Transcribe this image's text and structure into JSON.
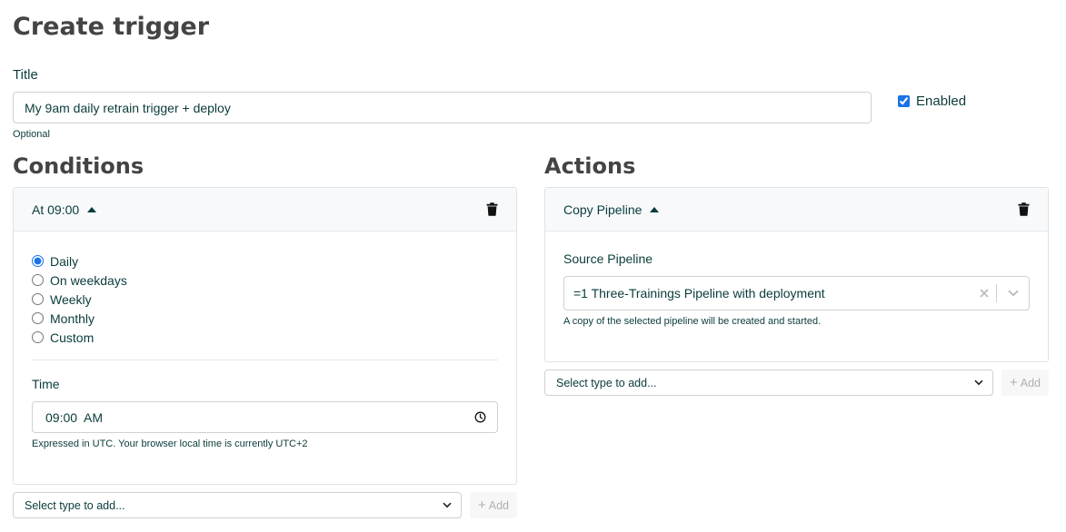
{
  "page": {
    "title": "Create trigger"
  },
  "title_field": {
    "label": "Title",
    "value": "My 9am daily retrain trigger + deploy",
    "hint": "Optional"
  },
  "enabled": {
    "label": "Enabled",
    "checked": true
  },
  "conditions": {
    "heading": "Conditions",
    "card": {
      "summary": "At 09:00",
      "schedule_options": [
        "Daily",
        "On weekdays",
        "Weekly",
        "Monthly",
        "Custom"
      ],
      "selected_option": "Daily",
      "time_label": "Time",
      "time_value": "09:00  AM",
      "time_hint": "Expressed in UTC. Your browser local time is currently UTC+2"
    },
    "add_select_placeholder": "Select type to add...",
    "add_button_label": "Add"
  },
  "actions": {
    "heading": "Actions",
    "card": {
      "summary": "Copy Pipeline",
      "source_label": "Source Pipeline",
      "source_value": "=1 Three-Trainings Pipeline with deployment",
      "source_hint": "A copy of the selected pipeline will be created and started."
    },
    "add_select_placeholder": "Select type to add...",
    "add_button_label": "Add"
  },
  "colors": {
    "accent": "#1a73e8",
    "heading": "#444444",
    "text": "#0b3b3b",
    "card_header_bg": "#f7f9fb"
  }
}
